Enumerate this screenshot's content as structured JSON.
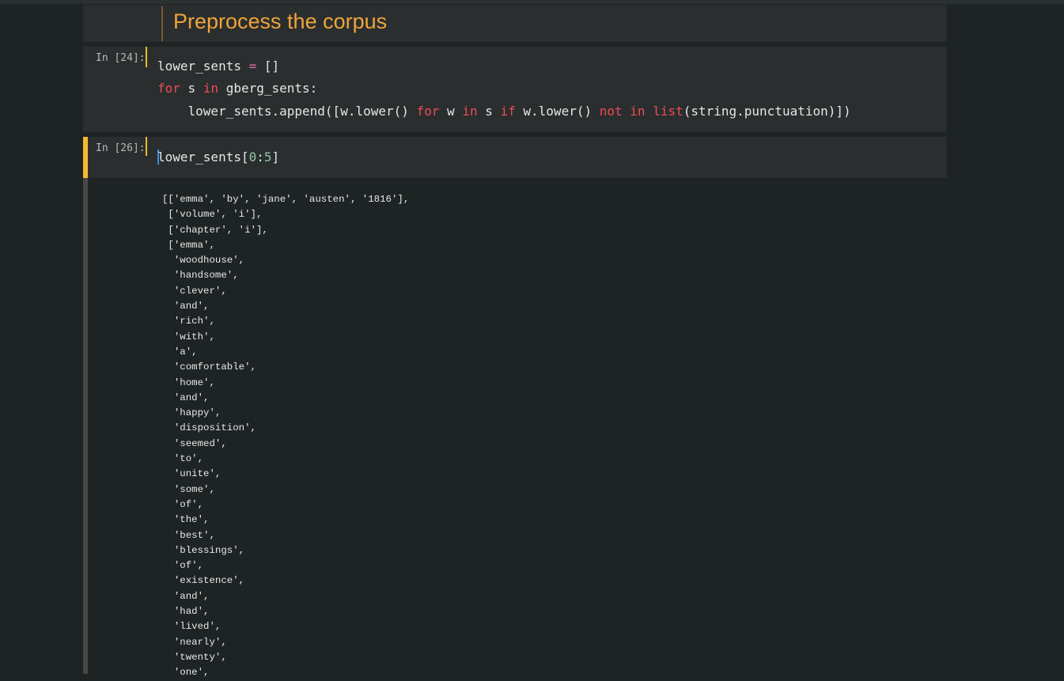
{
  "markdown": {
    "title": "Preprocess the corpus"
  },
  "cells": [
    {
      "prompt": "In [24]:",
      "lines": [
        [
          [
            "v",
            "lower_sents "
          ],
          [
            "op",
            "="
          ],
          [
            "v",
            " []"
          ]
        ],
        [
          [
            "kw",
            "for"
          ],
          [
            "v",
            " s "
          ],
          [
            "kw",
            "in"
          ],
          [
            "v",
            " gberg_sents:"
          ]
        ],
        [
          [
            "v",
            "    lower_sents.append([w.lower() "
          ],
          [
            "kw",
            "for"
          ],
          [
            "v",
            " w "
          ],
          [
            "kw",
            "in"
          ],
          [
            "v",
            " s "
          ],
          [
            "kw",
            "if"
          ],
          [
            "v",
            " w.lower() "
          ],
          [
            "kw",
            "not"
          ],
          [
            "v",
            " "
          ],
          [
            "kw",
            "in"
          ],
          [
            "v",
            " "
          ],
          [
            "kw",
            "list"
          ],
          [
            "v",
            "(string.punctuation)])"
          ]
        ]
      ]
    },
    {
      "prompt": "In [26]:",
      "lines": [
        [
          [
            "v",
            "lower_sents["
          ],
          [
            "num",
            "0"
          ],
          [
            "v",
            ":"
          ],
          [
            "num",
            "5"
          ],
          [
            "v",
            "]"
          ]
        ]
      ]
    }
  ],
  "output": {
    "lines": [
      "[['emma', 'by', 'jane', 'austen', '1816'],",
      " ['volume', 'i'],",
      " ['chapter', 'i'],",
      " ['emma',",
      "  'woodhouse',",
      "  'handsome',",
      "  'clever',",
      "  'and',",
      "  'rich',",
      "  'with',",
      "  'a',",
      "  'comfortable',",
      "  'home',",
      "  'and',",
      "  'happy',",
      "  'disposition',",
      "  'seemed',",
      "  'to',",
      "  'unite',",
      "  'some',",
      "  'of',",
      "  'the',",
      "  'best',",
      "  'blessings',",
      "  'of',",
      "  'existence',",
      "  'and',",
      "  'had',",
      "  'lived',",
      "  'nearly',",
      "  'twenty',",
      "  'one',"
    ]
  },
  "colors": {
    "background": "#1e2324",
    "cell_background": "#2a2e2f",
    "heading": "#f0a43a",
    "keyword": "#ee4b56",
    "operator": "#e66aa8",
    "number": "#8fc7a5",
    "selected_cell_bar": "#f5b82e",
    "cursor": "#3a8fdc"
  }
}
